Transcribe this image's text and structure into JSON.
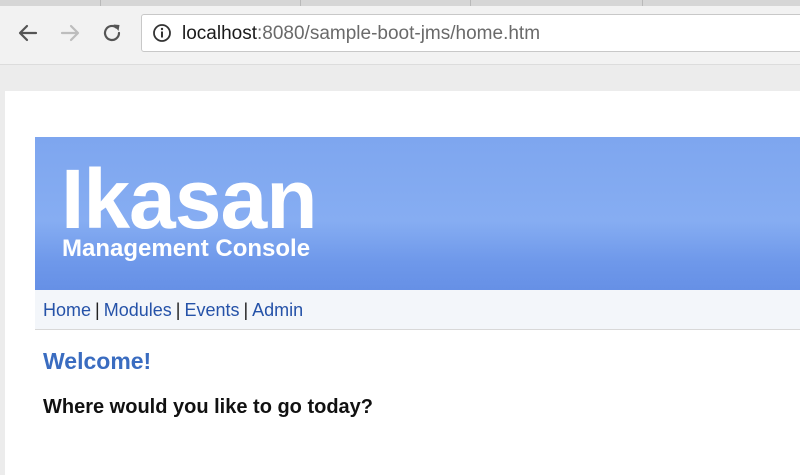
{
  "browser": {
    "url_host": "localhost",
    "url_rest": ":8080/sample-boot-jms/home.htm"
  },
  "page": {
    "brand": {
      "title": "Ikasan",
      "subtitle": "Management Console"
    },
    "nav": {
      "items": [
        {
          "label": "Home"
        },
        {
          "label": "Modules"
        },
        {
          "label": "Events"
        },
        {
          "label": "Admin"
        }
      ],
      "separator": "|"
    },
    "heading": "Welcome!",
    "prompt": "Where would you like to go today?"
  },
  "colors": {
    "banner": "#7ea6ef",
    "link": "#2552a8",
    "heading": "#3a6cc0"
  }
}
